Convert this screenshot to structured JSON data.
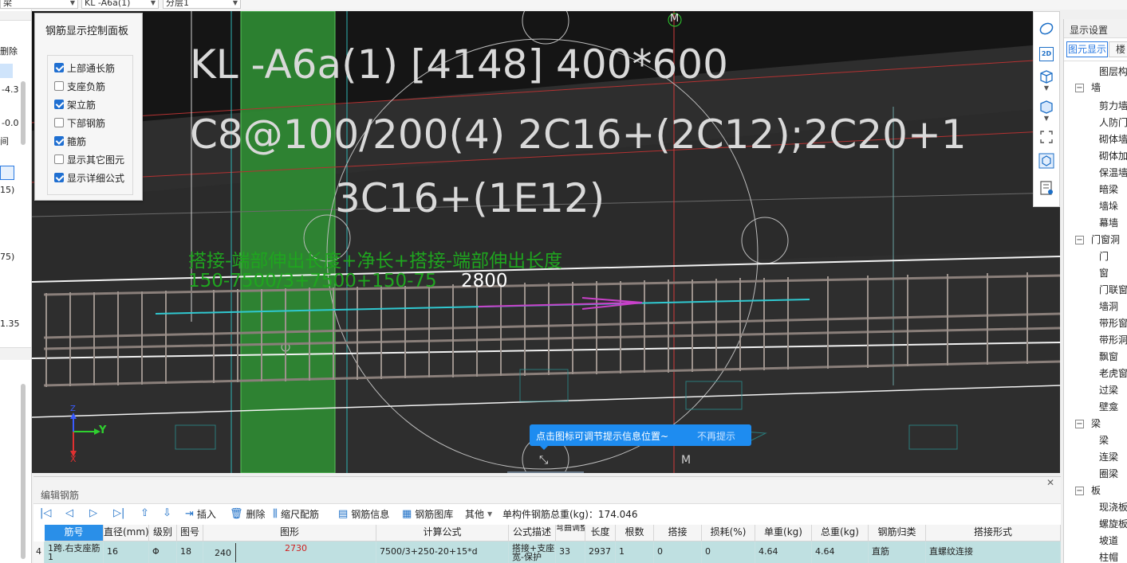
{
  "toolbar": {
    "combo1": "梁",
    "combo2": "KL -A6a(1)",
    "combo3": "分层1"
  },
  "left_strip": {
    "texts": [
      "删除",
      "-4.3",
      "-0.0",
      "间",
      "15)",
      "75)",
      "1.35"
    ]
  },
  "viewport": {
    "label_line1": "KL -A6a(1) [4148] 400*600",
    "label_line2": "C8@100/200(4) 2C16+(2C12);2C20+1",
    "label_line3": "3C16+(1E12)",
    "formula_desc": "搭接-端部伸出长度+净长+搭接-端部伸出长度",
    "formula_values": "150-7500/3+7500+150-75",
    "length_value": "2800",
    "marker_top": "M",
    "marker_bottom": "M",
    "axis_y": "Y",
    "axis_x": "X",
    "axis_z": "Z"
  },
  "control_panel": {
    "title": "钢筋显示控制面板",
    "items": [
      {
        "label": "上部通长筋",
        "checked": true
      },
      {
        "label": "支座负筋",
        "checked": false
      },
      {
        "label": "架立筋",
        "checked": true
      },
      {
        "label": "下部钢筋",
        "checked": false
      },
      {
        "label": "箍筋",
        "checked": true
      },
      {
        "label": "显示其它图元",
        "checked": false
      },
      {
        "label": "显示详细公式",
        "checked": true
      }
    ]
  },
  "right_tools": {
    "icons": [
      "orbit-icon",
      "2d-view-icon",
      "3d-box-icon",
      "cube-solid-icon",
      "fit-view-icon",
      "component-icon",
      "rebar-list-icon"
    ],
    "label_2d": "2D"
  },
  "display_settings": {
    "title": "显示设置",
    "tab_active": "图元显示",
    "tab_other": "楼",
    "header": "图层构",
    "groups": [
      {
        "name": "墙",
        "items": [
          "剪力墙",
          "人防门",
          "砌体墙",
          "砌体加",
          "保温墙",
          "暗梁",
          "墙垛",
          "幕墙"
        ]
      },
      {
        "name": "门窗洞",
        "items": [
          "门",
          "窗",
          "门联窗",
          "墙洞",
          "带形窗",
          "带形洞",
          "飘窗",
          "老虎窗",
          "过梁",
          "壁龛"
        ]
      },
      {
        "name": "梁",
        "items": [
          "梁",
          "连梁",
          "圈梁"
        ]
      },
      {
        "name": "板",
        "items": [
          "现浇板",
          "螺旋板",
          "坡道",
          "柱帽"
        ]
      }
    ]
  },
  "edit_rebar": {
    "title": "编辑钢筋",
    "toolbar": {
      "insert": "插入",
      "delete": "删除",
      "scale": "缩尺配筋",
      "info": "钢筋信息",
      "library": "钢筋图库",
      "other": "其他",
      "total_label": "单构件钢筋总重(kg)：174.046"
    },
    "columns": [
      "筋号",
      "直径(mm)",
      "级别",
      "图号",
      "图形",
      "计算公式",
      "公式描述",
      "弯曲调整",
      "长度",
      "根数",
      "搭接",
      "损耗(%)",
      "单重(kg)",
      "总重(kg)",
      "钢筋归类",
      "搭接形式"
    ],
    "row": {
      "index": "4",
      "name": "1跨.右支座筋1",
      "diameter": "16",
      "grade": "Φ",
      "figure_no": "18",
      "shape_left": "240",
      "shape_len": "2730",
      "formula": "7500/3+250-20+15*d",
      "desc": "搭接+支座宽-保护",
      "bend": "33",
      "length": "2937",
      "count": "1",
      "lap": "0",
      "loss": "0",
      "unit_weight": "4.64",
      "total_weight": "4.64",
      "category": "直筋",
      "lap_type": "直螺纹连接"
    }
  },
  "tip": {
    "text": "点击图标可调节提示信息位置~",
    "dismiss": "不再提示"
  },
  "colors": {
    "viewport_bg": "#2e2e2e",
    "accent": "#1e8cf0",
    "formula_green": "#1fa51f",
    "label_pink": "#d9a0d0",
    "row_bg": "#bfe0e1"
  }
}
